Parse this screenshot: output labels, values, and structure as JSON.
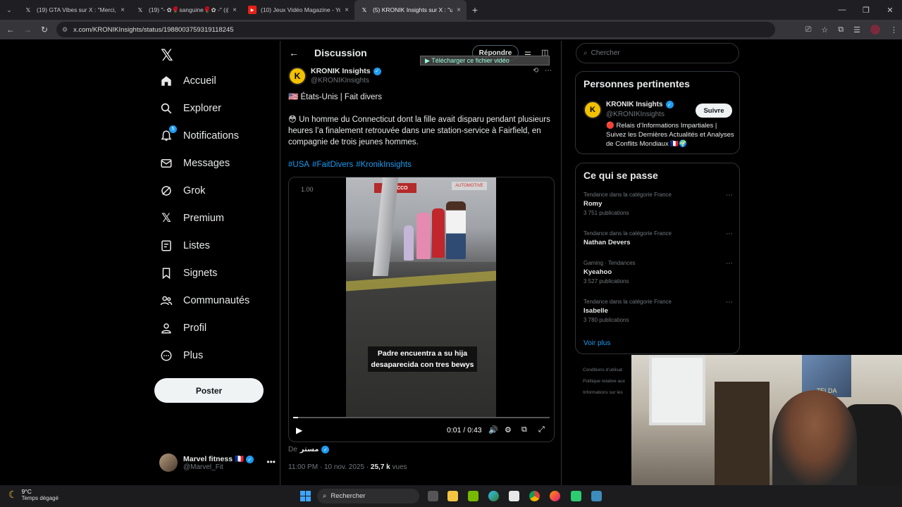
{
  "browser": {
    "tabs": [
      {
        "title": "(19) GTA Vibes sur X : \"Merci, G",
        "icon": "x-logo"
      },
      {
        "title": "(19) \"- ✿🌹sanguine🌹✿ -\" (@",
        "icon": "x-logo"
      },
      {
        "title": "(10) Jeux Vidéo Magazine - You",
        "icon": "youtube-logo"
      },
      {
        "title": "(5) KRONIK Insights sur X : \"us",
        "icon": "x-logo"
      }
    ],
    "url": "x.com/KRONIKInsights/status/1988003759319118245"
  },
  "sidebar": {
    "items": [
      {
        "label": "Accueil",
        "icon": "home-icon"
      },
      {
        "label": "Explorer",
        "icon": "search-icon"
      },
      {
        "label": "Notifications",
        "icon": "bell-icon",
        "badge": "5"
      },
      {
        "label": "Messages",
        "icon": "mail-icon"
      },
      {
        "label": "Grok",
        "icon": "grok-icon"
      },
      {
        "label": "Premium",
        "icon": "x-logo-icon"
      },
      {
        "label": "Listes",
        "icon": "list-icon"
      },
      {
        "label": "Signets",
        "icon": "bookmark-icon"
      },
      {
        "label": "Communautés",
        "icon": "people-icon"
      },
      {
        "label": "Profil",
        "icon": "person-icon"
      },
      {
        "label": "Plus",
        "icon": "more-circle-icon"
      }
    ],
    "post_button": "Poster",
    "account": {
      "name": "Marvel fitness 🇫🇷",
      "handle": "@Marvel_Fit"
    }
  },
  "main": {
    "title": "Discussion",
    "reply_button": "Répondre",
    "download_overlay": "▶ Télécharger ce fichier vidéo",
    "author": {
      "name": "KRONIK Insights",
      "handle": "@KRONIKInsights"
    },
    "line1": "🇺🇸 États-Unis | Fait divers",
    "line2": "😳 Un homme du Connecticut dont la fille avait disparu pendant plusieurs heures l’a finalement retrouvée dans une station-service à Fairfield, en compagnie de trois jeunes hommes.",
    "hashtags": [
      "#USA",
      "#FaitDivers",
      "#KronikInsights"
    ],
    "video": {
      "speed": "1.00",
      "caption_line1": "Padre encuentra  a su hija",
      "caption_line2": "desaparecida con tres bewys",
      "sign": "TOBACCO",
      "sign2": "AUTOMOTIVE",
      "time": "0:01 / 0:43",
      "progress": 0.02
    },
    "from_label": "De",
    "from_name": "مستر",
    "meta_time": "11:00 PM · 10 nov. 2025 · ",
    "meta_views": "25,7 k",
    "meta_views_label": " vues"
  },
  "right": {
    "search_placeholder": "Chercher",
    "relevant_title": "Personnes pertinentes",
    "rec": {
      "name": "KRONIK Insights",
      "handle": "@KRONIKInsights",
      "follow": "Suivre",
      "bio": "🔴 Relais d’Informations Impartiales | Suivez les Dernières Actualités et Analyses de Conflits Mondiaux 🇫🇷🌍"
    },
    "trends_title": "Ce qui se passe",
    "trends": [
      {
        "category": "Tendance dans la catégorie France",
        "name": "Romy",
        "count": "3 751 publications"
      },
      {
        "category": "Tendance dans la catégorie France",
        "name": "Nathan Devers",
        "count": ""
      },
      {
        "category": "Gaming · Tendances",
        "name": "Kyeahoo",
        "count": "3 527 publications"
      },
      {
        "category": "Tendance dans la catégorie France",
        "name": "Isabelle",
        "count": "3 780 publications"
      }
    ],
    "see_more": "Voir plus",
    "footer": [
      "Conditions d’utilisat",
      "Politique relative aux",
      "Informations sur les"
    ]
  },
  "webcam": {
    "poster_text": "ZELDA"
  },
  "taskbar": {
    "temp": "9°C",
    "weather": "Temps dégagé",
    "search": "Rechercher"
  }
}
